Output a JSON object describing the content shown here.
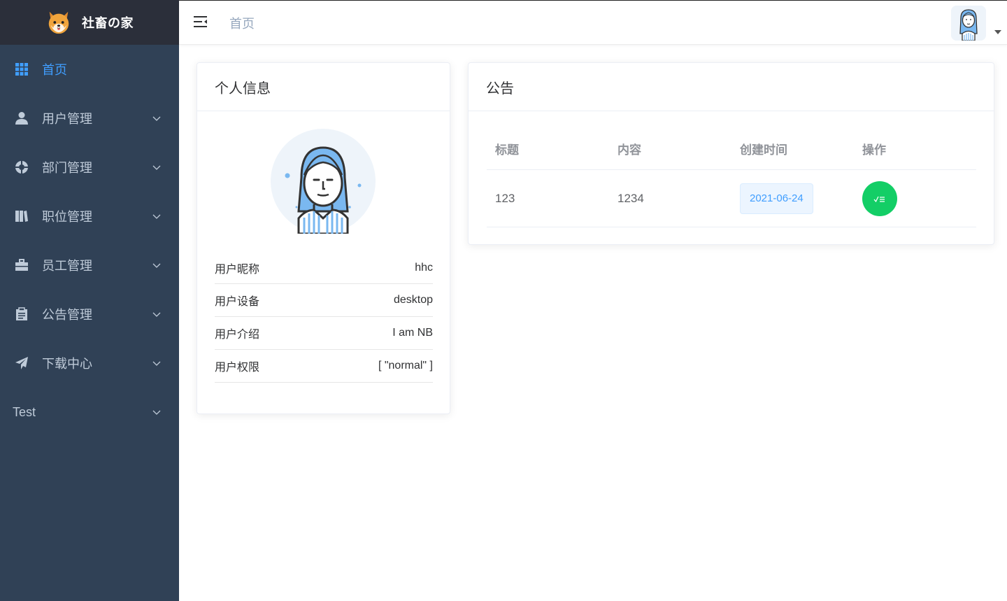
{
  "app": {
    "logo_text": "社畜の家"
  },
  "sidebar": {
    "items": [
      {
        "label": "首页",
        "icon": "grid-icon",
        "active": true
      },
      {
        "label": "用户管理",
        "icon": "user-icon"
      },
      {
        "label": "部门管理",
        "icon": "lifebuoy-icon"
      },
      {
        "label": "职位管理",
        "icon": "books-icon"
      },
      {
        "label": "员工管理",
        "icon": "briefcase-icon"
      },
      {
        "label": "公告管理",
        "icon": "clipboard-icon"
      },
      {
        "label": "下载中心",
        "icon": "paper-plane-icon"
      },
      {
        "label": "Test",
        "icon": ""
      }
    ]
  },
  "header": {
    "breadcrumb": "首页"
  },
  "profile_card": {
    "title": "个人信息",
    "rows": [
      {
        "label": "用户昵称",
        "value": "hhc"
      },
      {
        "label": "用户设备",
        "value": "desktop"
      },
      {
        "label": "用户介绍",
        "value": "I am NB"
      },
      {
        "label": "用户权限",
        "value": "[ \"normal\" ]"
      }
    ]
  },
  "notice_card": {
    "title": "公告",
    "columns": [
      "标题",
      "内容",
      "创建时间",
      "操作"
    ],
    "rows": [
      {
        "title": "123",
        "content": "1234",
        "created": "2021-06-24"
      }
    ]
  },
  "colors": {
    "sidebar_bg": "#304156",
    "logo_bar_bg": "#2b2f3a",
    "accent": "#409eff",
    "action_green": "#13ce66"
  }
}
